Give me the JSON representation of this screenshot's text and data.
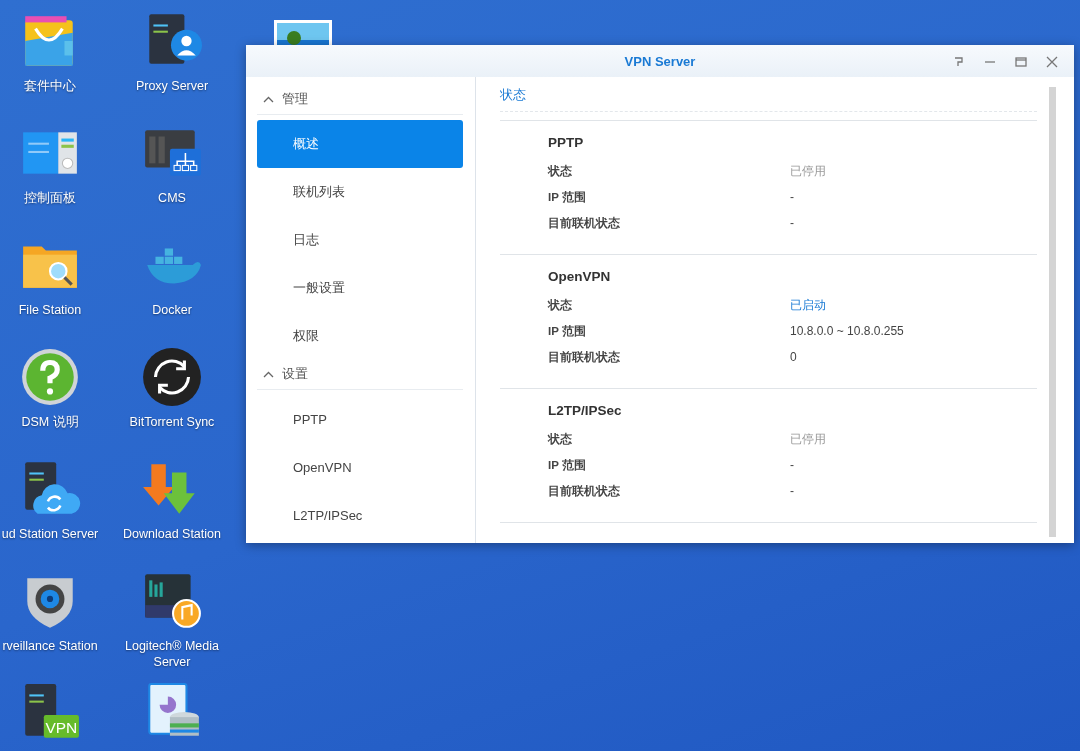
{
  "desktop_icons": [
    {
      "kind": "package-bag",
      "label": "套件中心"
    },
    {
      "kind": "server-person",
      "label": "Proxy Server"
    },
    {
      "kind": "control-panel",
      "label": "控制面板"
    },
    {
      "kind": "nas-network",
      "label": "CMS"
    },
    {
      "kind": "folder-search",
      "label": "File Station"
    },
    {
      "kind": "whale",
      "label": "Docker"
    },
    {
      "kind": "help",
      "label": "DSM 说明"
    },
    {
      "kind": "sync",
      "label": "BitTorrent Sync"
    },
    {
      "kind": "server-cloud",
      "label": "ud Station Server"
    },
    {
      "kind": "download",
      "label": "Download Station"
    },
    {
      "kind": "camera",
      "label": "rveillance Station"
    },
    {
      "kind": "music-server",
      "label": "Logitech® Media Server"
    },
    {
      "kind": "server-badge",
      "badge": "VPN"
    },
    {
      "kind": "database-chart"
    }
  ],
  "window": {
    "title": "VPN Server",
    "sidebar": [
      {
        "label": "管理",
        "expanded": true,
        "items": [
          {
            "label": "概述",
            "selected": true
          },
          {
            "label": "联机列表",
            "selected": false
          },
          {
            "label": "日志",
            "selected": false
          },
          {
            "label": "一般设置",
            "selected": false
          },
          {
            "label": "权限",
            "selected": false
          }
        ]
      },
      {
        "label": "设置",
        "expanded": true,
        "items": [
          {
            "label": "PPTP",
            "selected": false
          },
          {
            "label": "OpenVPN",
            "selected": false
          },
          {
            "label": "L2TP/IPSec",
            "selected": false
          }
        ]
      }
    ],
    "content_title": "状态",
    "services": [
      {
        "name": "PPTP",
        "rows": [
          {
            "label": "状态",
            "value": "已停用",
            "enabled": false
          },
          {
            "label": "IP 范围",
            "value": "-"
          },
          {
            "label": "目前联机状态",
            "value": "-"
          }
        ]
      },
      {
        "name": "OpenVPN",
        "rows": [
          {
            "label": "状态",
            "value": "已启动",
            "enabled": true
          },
          {
            "label": "IP 范围",
            "value": "10.8.0.0 ~ 10.8.0.255"
          },
          {
            "label": "目前联机状态",
            "value": "0"
          }
        ]
      },
      {
        "name": "L2TP/IPSec",
        "rows": [
          {
            "label": "状态",
            "value": "已停用",
            "enabled": false
          },
          {
            "label": "IP 范围",
            "value": "-"
          },
          {
            "label": "目前联机状态",
            "value": "-"
          }
        ]
      }
    ]
  }
}
